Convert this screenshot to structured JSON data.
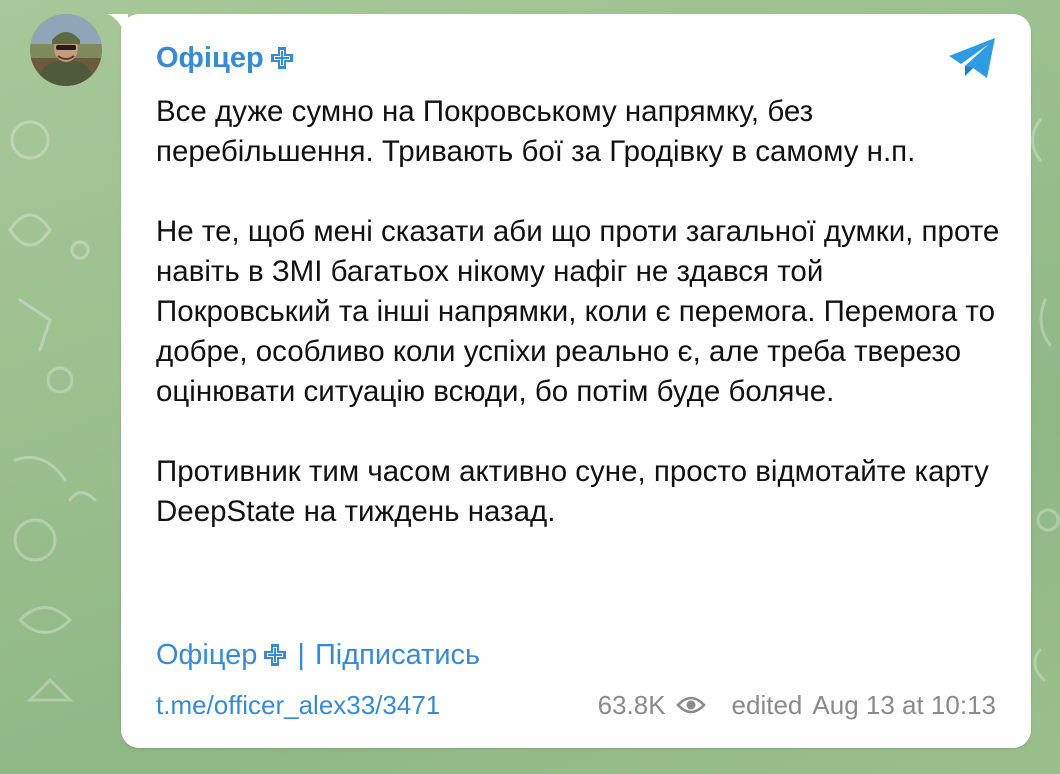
{
  "channel": {
    "name": "Офіцер",
    "accent_color": "#3a8ad0"
  },
  "message": {
    "paragraphs": [
      "Все дуже сумно на Покровському напрямку, без перебільшення. Тривають бої за Гродівку в самому н.п.",
      "Не те, щоб мені сказати аби що проти загальної думки, проте навіть в ЗМІ багатьох нікому нафіг не здався той Покровський та інші напрямки, коли є перемога. Перемога то добре, особливо коли успіхи реально є, але треба тверезо оцінювати ситуацію всюди, бо потім буде боляче.",
      "Противник тим часом активно суне, просто відмотайте карту DeepState на тиждень назад."
    ]
  },
  "footer": {
    "signature_name": "Офіцер",
    "separator": "|",
    "subscribe_label": "Підписатись",
    "link": "t.me/officer_alex33/3471",
    "views": "63.8K",
    "edited_label": "edited",
    "timestamp": "Aug 13 at 10:13"
  },
  "icons": {
    "cross": "medical-cross-icon",
    "telegram": "telegram-plane-icon",
    "eye": "eye-icon"
  }
}
